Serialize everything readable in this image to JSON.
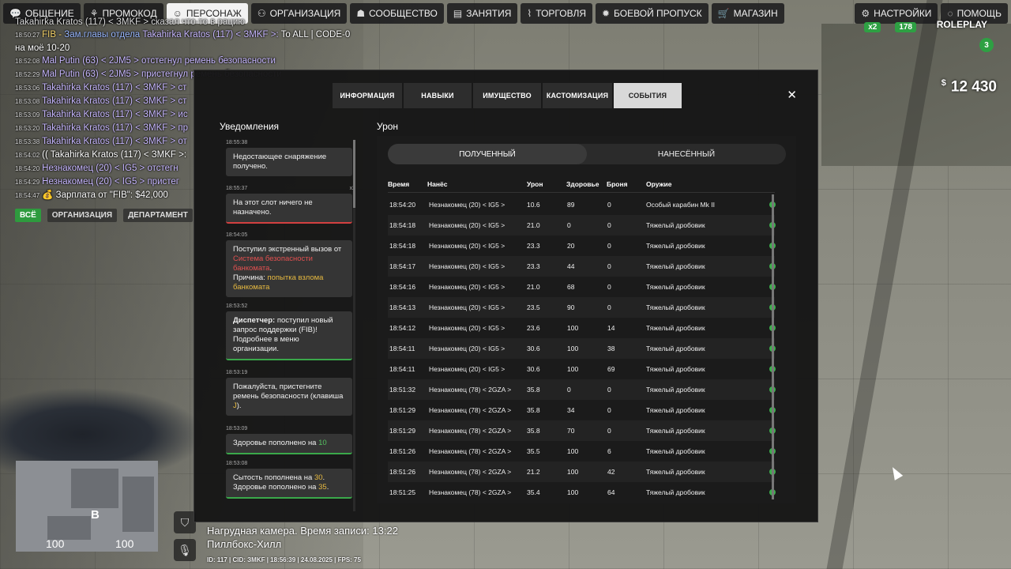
{
  "nav": {
    "left": [
      {
        "icon": "chat-icon",
        "glyph": "💬",
        "label": "ОБЩЕНИЕ",
        "active": false
      },
      {
        "icon": "promo-icon",
        "glyph": "⚘",
        "label": "ПРОМОКОД",
        "active": false
      },
      {
        "icon": "person-icon",
        "glyph": "☺",
        "label": "ПЕРСОНАЖ",
        "active": true
      },
      {
        "icon": "organization-icon",
        "glyph": "⚇",
        "label": "ОРГАНИЗАЦИЯ",
        "active": false
      },
      {
        "icon": "community-icon",
        "glyph": "☗",
        "label": "СООБЩЕСТВО",
        "active": false
      },
      {
        "icon": "activities-icon",
        "glyph": "▤",
        "label": "ЗАНЯТИЯ",
        "active": false
      },
      {
        "icon": "trade-icon",
        "glyph": "⌇",
        "label": "ТОРГОВЛЯ",
        "active": false
      },
      {
        "icon": "battlepass-icon",
        "glyph": "✹",
        "label": "БОЕВОЙ ПРОПУСК",
        "active": false
      },
      {
        "icon": "cart-icon",
        "glyph": "🛒",
        "label": "МАГАЗИН",
        "active": false
      }
    ],
    "right": [
      {
        "icon": "settings-icon",
        "glyph": "⚙",
        "label": "НАСТРОЙКИ"
      },
      {
        "icon": "help-icon",
        "glyph": "◌",
        "label": "ПОМОЩЬ"
      }
    ]
  },
  "chat": {
    "lines": [
      {
        "time": "",
        "parts": [
          {
            "t": "Takahirka Kratos (117) < ЗMKF > сказал что-то в рацию",
            "c": "c-grey"
          }
        ]
      },
      {
        "time": "18:50:27",
        "parts": [
          {
            "t": "FIB - ",
            "c": "c-yellow"
          },
          {
            "t": "Зам.главы отдела ",
            "c": "c-blue"
          },
          {
            "t": "Takahirka Kratos (117) < ЗMKF >: ",
            "c": "c-name"
          },
          {
            "t": "To ALL | CODE-0",
            "c": "c-white"
          }
        ]
      },
      {
        "time": "",
        "parts": [
          {
            "t": "на моё 10-20",
            "c": "c-white"
          }
        ]
      },
      {
        "time": "18:52:08",
        "parts": [
          {
            "t": "Mal Putin (63) < 2JM5 > отстегнул ремень безопасности",
            "c": "c-name"
          }
        ]
      },
      {
        "time": "18:52:29",
        "parts": [
          {
            "t": "Mal Putin (63) < 2JM5 > пристегнул ремень безопасности",
            "c": "c-name"
          }
        ]
      },
      {
        "time": "18:53:06",
        "parts": [
          {
            "t": "Takahirka Kratos (117) < ЗMKF > ст",
            "c": "c-name"
          }
        ]
      },
      {
        "time": "18:53:08",
        "parts": [
          {
            "t": "Takahirka Kratos (117) < ЗMKF > ст",
            "c": "c-name"
          }
        ]
      },
      {
        "time": "18:53:09",
        "parts": [
          {
            "t": "Takahirka Kratos (117) < ЗMKF > ис",
            "c": "c-name"
          }
        ]
      },
      {
        "time": "18:53:20",
        "parts": [
          {
            "t": "Takahirka Kratos (117) < ЗMKF > пр",
            "c": "c-name"
          }
        ]
      },
      {
        "time": "18:53:38",
        "parts": [
          {
            "t": "Takahirka Kratos (117) < ЗMKF > от",
            "c": "c-name"
          }
        ]
      },
      {
        "time": "18:54:02",
        "parts": [
          {
            "t": "(( Takahirka Kratos (117) < ЗMKF >: ",
            "c": "c-white"
          }
        ]
      },
      {
        "time": "18:54:20",
        "parts": [
          {
            "t": "Незнакомец (20) < IG5 > отстегн",
            "c": "c-name"
          }
        ]
      },
      {
        "time": "18:54:29",
        "parts": [
          {
            "t": "Незнакомец (20) < IG5 > пристег",
            "c": "c-name"
          }
        ]
      },
      {
        "time": "18:54:47",
        "parts": [
          {
            "t": "💰 Зарплата от \"FIB\": $42,000",
            "c": "c-white"
          }
        ]
      }
    ],
    "tabs": [
      {
        "label": "ВСЁ",
        "active": true
      },
      {
        "label": "ОРГАНИЗАЦИЯ",
        "active": false
      },
      {
        "label": "ДЕПАРТАМЕНТ",
        "active": false
      }
    ]
  },
  "hud": {
    "money_symbol": "$",
    "money": "12 430",
    "logo": "ROLEPLAY",
    "badge1": "x2",
    "badge2": "178",
    "level": "3",
    "map_letter": "B",
    "speed_left": "100",
    "speed_right": "100"
  },
  "bottom": {
    "camera": "Нагрудная камера. Время записи: 13:22",
    "location": "Пиллбокс-Хилл",
    "meta": "ID: 117 | CID: ЗMKF | 18:56:39  | 24.08.2025 | FPS: 75"
  },
  "panel": {
    "tabs": [
      {
        "label": "ИНФОРМАЦИЯ",
        "active": false
      },
      {
        "label": "НАВЫКИ",
        "active": false
      },
      {
        "label": "ИМУЩЕСТВО",
        "active": false
      },
      {
        "label": "КАСТОМИЗАЦИЯ",
        "active": false
      },
      {
        "label": "СОБЫТИЯ",
        "active": true
      }
    ],
    "close": "✕",
    "notifications_title": "Уведомления",
    "damage_title": "Урон",
    "toggle": {
      "received": "ПОЛУЧЕННЫЙ",
      "dealt": "НАНЕСЁННЫЙ",
      "active": "received"
    },
    "columns": {
      "time": "Время",
      "attacker": "Нанёс",
      "damage": "Урон",
      "health": "Здоровье",
      "armor": "Броня",
      "weapon": "Оружие"
    }
  },
  "notifications": [
    {
      "time": "18:55:38",
      "count": "",
      "border": "",
      "parts": [
        {
          "t": "Недостающее снаряжение получено.",
          "c": ""
        }
      ]
    },
    {
      "time": "18:55:37",
      "count": "x2",
      "border": "red",
      "parts": [
        {
          "t": "На этот слот ничего не назначено.",
          "c": ""
        }
      ]
    },
    {
      "time": "18:54:05",
      "count": "",
      "border": "",
      "parts": [
        {
          "t": "Поступил экстренный вызов от ",
          "c": ""
        },
        {
          "t": "Система безопасности банкомата",
          "c": "t-red"
        },
        {
          "t": ".",
          "c": ""
        },
        {
          "t": "\nПричина: ",
          "c": ""
        },
        {
          "t": "попытка взлома банкомата",
          "c": "t-yellow"
        }
      ]
    },
    {
      "time": "18:53:52",
      "count": "",
      "border": "green",
      "parts": [
        {
          "t": "Диспетчер:",
          "c": "b"
        },
        {
          "t": " поступил новый запрос поддержки (FIB)! Подробнее в меню организации.",
          "c": ""
        }
      ]
    },
    {
      "time": "18:53:19",
      "count": "",
      "border": "",
      "parts": [
        {
          "t": "Пожалуйста, пристегните ремень безопасности (клавиша ",
          "c": ""
        },
        {
          "t": "J",
          "c": "t-yellow"
        },
        {
          "t": ").",
          "c": ""
        }
      ]
    },
    {
      "time": "18:53:09",
      "count": "",
      "border": "green",
      "parts": [
        {
          "t": "Здоровье пополнено на ",
          "c": ""
        },
        {
          "t": "10",
          "c": "t-green"
        }
      ]
    },
    {
      "time": "18:53:08",
      "count": "",
      "border": "green",
      "parts": [
        {
          "t": "Сытость пополнена на ",
          "c": ""
        },
        {
          "t": "30",
          "c": "t-yellow"
        },
        {
          "t": ".\nЗдоровье пополнено на ",
          "c": ""
        },
        {
          "t": "35",
          "c": "t-yellow"
        },
        {
          "t": ".",
          "c": ""
        }
      ]
    }
  ],
  "damage_rows": [
    {
      "time": "18:54:20",
      "attacker": "Незнакомец (20) < IG5 >",
      "damage": "10.6",
      "health": "89",
      "armor": "0",
      "weapon": "Особый карабин Mk II"
    },
    {
      "time": "18:54:18",
      "attacker": "Незнакомец (20) < IG5 >",
      "damage": "21.0",
      "health": "0",
      "armor": "0",
      "weapon": "Тяжелый дробовик"
    },
    {
      "time": "18:54:18",
      "attacker": "Незнакомец (20) < IG5 >",
      "damage": "23.3",
      "health": "20",
      "armor": "0",
      "weapon": "Тяжелый дробовик"
    },
    {
      "time": "18:54:17",
      "attacker": "Незнакомец (20) < IG5 >",
      "damage": "23.3",
      "health": "44",
      "armor": "0",
      "weapon": "Тяжелый дробовик"
    },
    {
      "time": "18:54:16",
      "attacker": "Незнакомец (20) < IG5 >",
      "damage": "21.0",
      "health": "68",
      "armor": "0",
      "weapon": "Тяжелый дробовик"
    },
    {
      "time": "18:54:13",
      "attacker": "Незнакомец (20) < IG5 >",
      "damage": "23.5",
      "health": "90",
      "armor": "0",
      "weapon": "Тяжелый дробовик"
    },
    {
      "time": "18:54:12",
      "attacker": "Незнакомец (20) < IG5 >",
      "damage": "23.6",
      "health": "100",
      "armor": "14",
      "weapon": "Тяжелый дробовик"
    },
    {
      "time": "18:54:11",
      "attacker": "Незнакомец (20) < IG5 >",
      "damage": "30.6",
      "health": "100",
      "armor": "38",
      "weapon": "Тяжелый дробовик"
    },
    {
      "time": "18:54:11",
      "attacker": "Незнакомец (20) < IG5 >",
      "damage": "30.6",
      "health": "100",
      "armor": "69",
      "weapon": "Тяжелый дробовик"
    },
    {
      "time": "18:51:32",
      "attacker": "Незнакомец (78) < 2GZA >",
      "damage": "35.8",
      "health": "0",
      "armor": "0",
      "weapon": "Тяжелый дробовик"
    },
    {
      "time": "18:51:29",
      "attacker": "Незнакомец (78) < 2GZA >",
      "damage": "35.8",
      "health": "34",
      "armor": "0",
      "weapon": "Тяжелый дробовик"
    },
    {
      "time": "18:51:29",
      "attacker": "Незнакомец (78) < 2GZA >",
      "damage": "35.8",
      "health": "70",
      "armor": "0",
      "weapon": "Тяжелый дробовик"
    },
    {
      "time": "18:51:26",
      "attacker": "Незнакомец (78) < 2GZA >",
      "damage": "35.5",
      "health": "100",
      "armor": "6",
      "weapon": "Тяжелый дробовик"
    },
    {
      "time": "18:51:26",
      "attacker": "Незнакомец (78) < 2GZA >",
      "damage": "21.2",
      "health": "100",
      "armor": "42",
      "weapon": "Тяжелый дробовик"
    },
    {
      "time": "18:51:25",
      "attacker": "Незнакомец (78) < 2GZA >",
      "damage": "35.4",
      "health": "100",
      "armor": "64",
      "weapon": "Тяжелый дробовик"
    }
  ]
}
